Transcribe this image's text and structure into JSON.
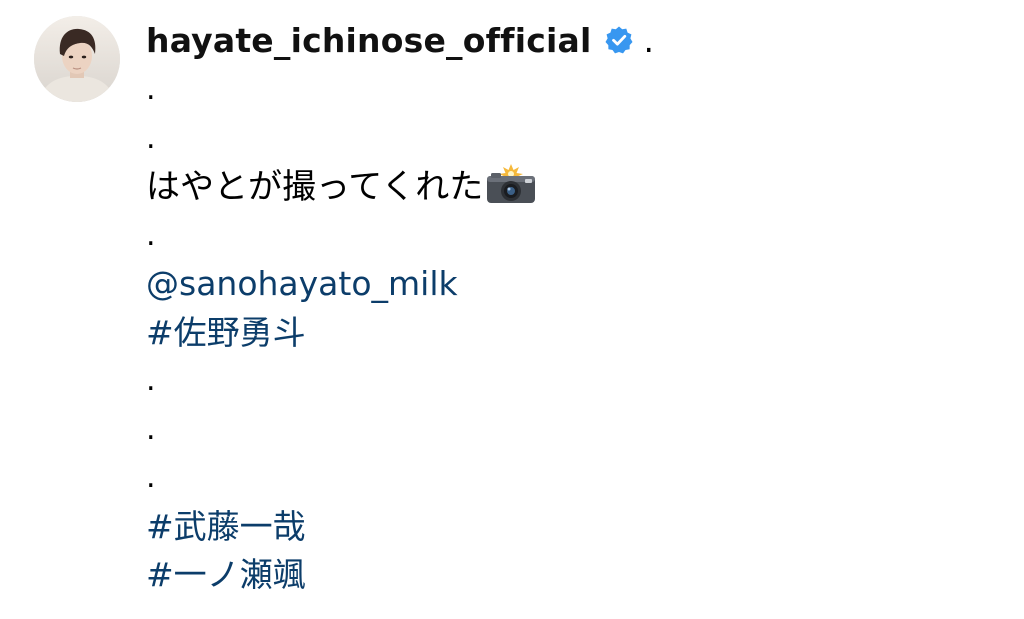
{
  "post": {
    "username": "hayate_ichinose_official",
    "verified_icon": "verified-badge-icon",
    "header_dot": ".",
    "caption": {
      "dot_1": ".",
      "dot_2": ".",
      "text": "はやとが撮ってくれた",
      "emoji_icon": "camera-with-flash-icon",
      "dot_3": ".",
      "mention": "@sanohayato_milk",
      "hashtag_1": "#佐野勇斗",
      "dot_4": ".",
      "dot_5": ".",
      "dot_6": ".",
      "hashtag_2": "#武藤一哉",
      "hashtag_3": "#一ノ瀬颯"
    }
  },
  "colors": {
    "link": "#0c3d6a",
    "verified_badge": "#3897f0",
    "text": "#000000"
  }
}
